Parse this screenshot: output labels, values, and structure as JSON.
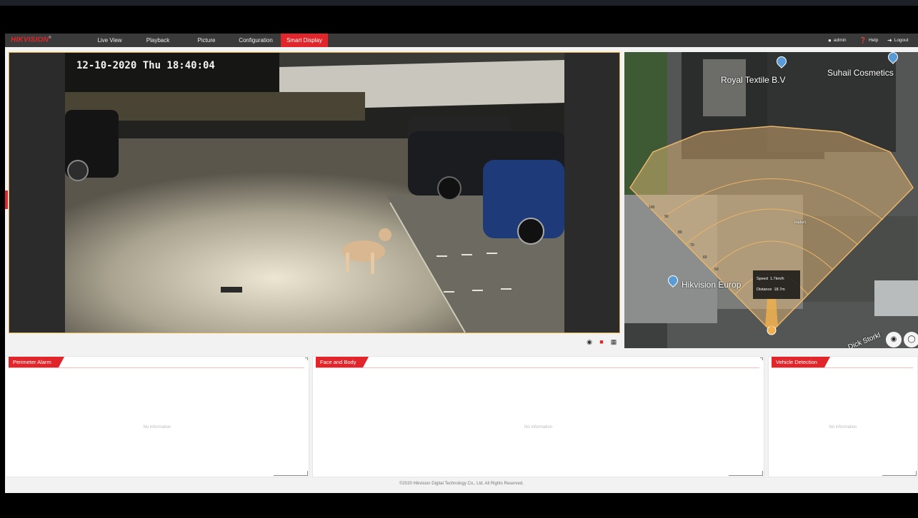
{
  "brand": {
    "logo": "HIKVISION",
    "logo_mark": "®"
  },
  "nav": {
    "tabs": [
      {
        "label": "Live View"
      },
      {
        "label": "Playback"
      },
      {
        "label": "Picture"
      },
      {
        "label": "Configuration"
      },
      {
        "label": "Smart Display"
      }
    ],
    "active_tab": "Smart Display",
    "user": "admin",
    "help": "Help",
    "logout": "Logout"
  },
  "video": {
    "osd_timestamp": "12-10-2020 Thu 18:40:04",
    "toolbar_icons": [
      "camera-icon",
      "record-icon",
      "layout-icon"
    ]
  },
  "map": {
    "places": [
      "Royal Textile B.V",
      "Suhail Cosmetics",
      "Hikvision Europ"
    ],
    "road_label": "Dick Storkl",
    "radar_label": "Radar1",
    "range_labels": [
      "100",
      "90",
      "80",
      "70",
      "60",
      "50"
    ],
    "tooltip": {
      "speed_label": "Speed",
      "speed_value": "1.7km/h",
      "distance_label": "Distance",
      "distance_value": "18.7m"
    },
    "buttons": [
      "layers-icon",
      "snapshot-icon"
    ]
  },
  "panels": [
    {
      "title": "Perimeter Alarm",
      "empty_text": "No information"
    },
    {
      "title": "Face and Body",
      "empty_text": "No information"
    },
    {
      "title": "Vehicle Detection",
      "empty_text": "No information"
    }
  ],
  "footer": "©2020 Hikvision Digital Technology Co., Ltd. All Rights Reserved.",
  "colors": {
    "accent": "#e0262b",
    "nav_bg": "#3a3a3a",
    "video_border": "#e3a838",
    "radar_fill": "#f0c27a"
  }
}
